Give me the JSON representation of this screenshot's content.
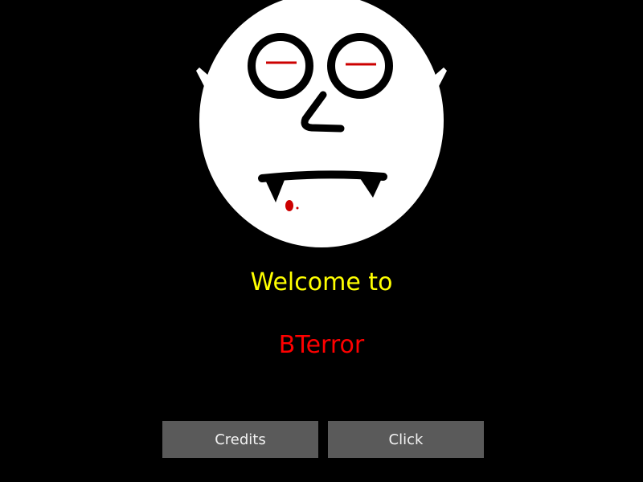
{
  "colors": {
    "background": "#000000",
    "welcome_text": "#ffff00",
    "title_text": "#ff0000",
    "button_bg": "#5a5a5a",
    "button_text": "#f2f2f2"
  },
  "header": {
    "logo_icon": "vampire-face-icon"
  },
  "main": {
    "welcome": "Welcome to",
    "title": "BTerror"
  },
  "buttons": {
    "credits": "Credits",
    "click": "Click"
  }
}
